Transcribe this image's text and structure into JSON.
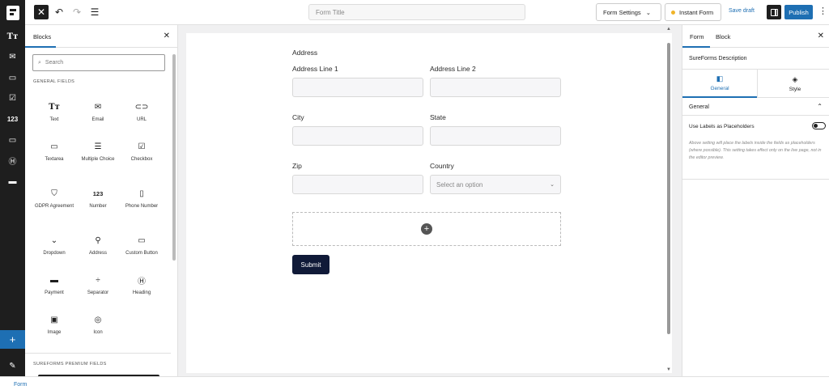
{
  "topbar": {
    "title_placeholder": "Form Title",
    "form_settings_label": "Form Settings",
    "instant_form_label": "Instant Form",
    "save_draft_label": "Save draft",
    "publish_label": "Publish"
  },
  "inserter": {
    "tab_label": "Blocks",
    "search_placeholder": "Search",
    "general_fields_title": "GENERAL FIELDS",
    "premium_fields_title": "SUREFORMS PREMIUM FIELDS",
    "blocks": [
      {
        "label": "Text",
        "icon": "text-icon"
      },
      {
        "label": "Email",
        "icon": "email-icon"
      },
      {
        "label": "URL",
        "icon": "link-icon"
      },
      {
        "label": "Textarea",
        "icon": "textarea-icon"
      },
      {
        "label": "Multiple Choice",
        "icon": "multiple-choice-icon"
      },
      {
        "label": "Checkbox",
        "icon": "checkbox-icon"
      },
      {
        "label": "GDPR Agreement",
        "icon": "shield-icon"
      },
      {
        "label": "Number",
        "icon": "number-icon"
      },
      {
        "label": "Phone Number",
        "icon": "phone-icon"
      },
      {
        "label": "Dropdown",
        "icon": "chevron-down-icon"
      },
      {
        "label": "Address",
        "icon": "location-pin-icon"
      },
      {
        "label": "Custom Button",
        "icon": "button-icon"
      },
      {
        "label": "Payment",
        "icon": "payment-card-icon"
      },
      {
        "label": "Separator",
        "icon": "separator-icon"
      },
      {
        "label": "Heading",
        "icon": "heading-icon"
      },
      {
        "label": "Image",
        "icon": "image-icon"
      },
      {
        "label": "Icon",
        "icon": "icon-icon"
      }
    ]
  },
  "iconbar": {
    "number_glyph": "123"
  },
  "form": {
    "section_label": "Address",
    "address_line_1_label": "Address Line 1",
    "address_line_2_label": "Address Line 2",
    "city_label": "City",
    "state_label": "State",
    "zip_label": "Zip",
    "country_label": "Country",
    "country_placeholder": "Select an option",
    "submit_label": "Submit"
  },
  "settings": {
    "tab_form": "Form",
    "tab_block": "Block",
    "description_label": "SureForms Description",
    "general_tab": "General",
    "style_tab": "Style",
    "general_heading": "General",
    "toggle_label": "Use Labels as Placeholders",
    "help_text": "Above setting will place the labels inside the fields as placeholders (where possible). This setting takes effect only on the live page, not in the editor preview."
  },
  "footer": {
    "breadcrumb": "Form"
  }
}
